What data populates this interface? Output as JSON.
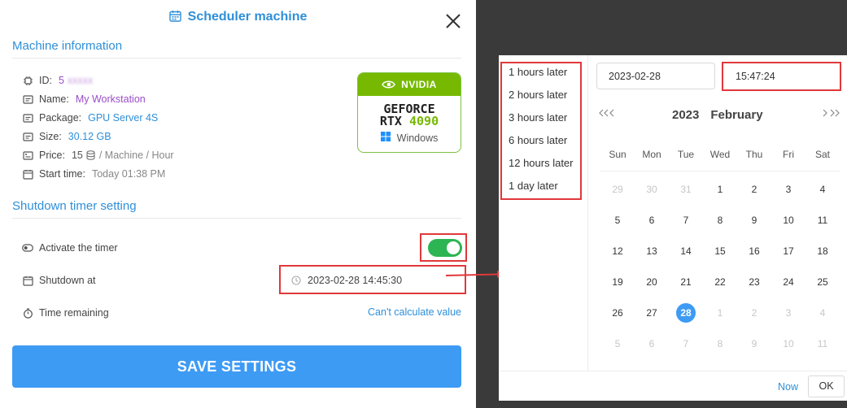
{
  "dialog": {
    "title": "Scheduler machine",
    "machine_info": {
      "heading": "Machine information",
      "id_label": "ID:",
      "id_value": "5",
      "id_blur": "xxxxx",
      "name_label": "Name:",
      "name_value": "My Workstation",
      "package_label": "Package:",
      "package_value": "GPU Server 4S",
      "size_label": "Size:",
      "size_value": "30.12 GB",
      "price_label": "Price:",
      "price_value": "15",
      "price_unit": "/ Machine / Hour",
      "start_label": "Start time:",
      "start_value": "Today 01:38 PM"
    },
    "gpu_card": {
      "brand": "NVIDIA",
      "line1": "GEFORCE",
      "line2_a": "RTX",
      "line2_b": "4090",
      "os": "Windows"
    },
    "timer": {
      "heading": "Shutdown timer setting",
      "activate_label": "Activate the timer",
      "activated": true,
      "shutdown_label": "Shutdown at",
      "shutdown_value": "2023-02-28 14:45:30",
      "remaining_label": "Time remaining",
      "remaining_value": "Can't calculate value"
    },
    "save_label": "SAVE SETTINGS"
  },
  "picker": {
    "presets": [
      "1 hours later",
      "2 hours later",
      "3 hours later",
      "6 hours later",
      "12 hours later",
      "1 day later"
    ],
    "date_value": "2023-02-28",
    "time_value": "15:47:24",
    "year": "2023",
    "month": "February",
    "weekdays": [
      "Sun",
      "Mon",
      "Tue",
      "Wed",
      "Thu",
      "Fri",
      "Sat"
    ],
    "weeks": [
      [
        "29",
        "30",
        "31",
        "1",
        "2",
        "3",
        "4"
      ],
      [
        "5",
        "6",
        "7",
        "8",
        "9",
        "10",
        "11"
      ],
      [
        "12",
        "13",
        "14",
        "15",
        "16",
        "17",
        "18"
      ],
      [
        "19",
        "20",
        "21",
        "22",
        "23",
        "24",
        "25"
      ],
      [
        "26",
        "27",
        "28",
        "1",
        "2",
        "3",
        "4"
      ],
      [
        "5",
        "6",
        "7",
        "8",
        "9",
        "10",
        "11"
      ]
    ],
    "selected_day": "28",
    "now_label": "Now",
    "ok_label": "OK"
  },
  "colors": {
    "accent": "#3d9bf4",
    "title_blue": "#2f8fd8",
    "toggle_on": "#2db554",
    "highlight": "#e0383b",
    "nvidia_green": "#76b900"
  }
}
